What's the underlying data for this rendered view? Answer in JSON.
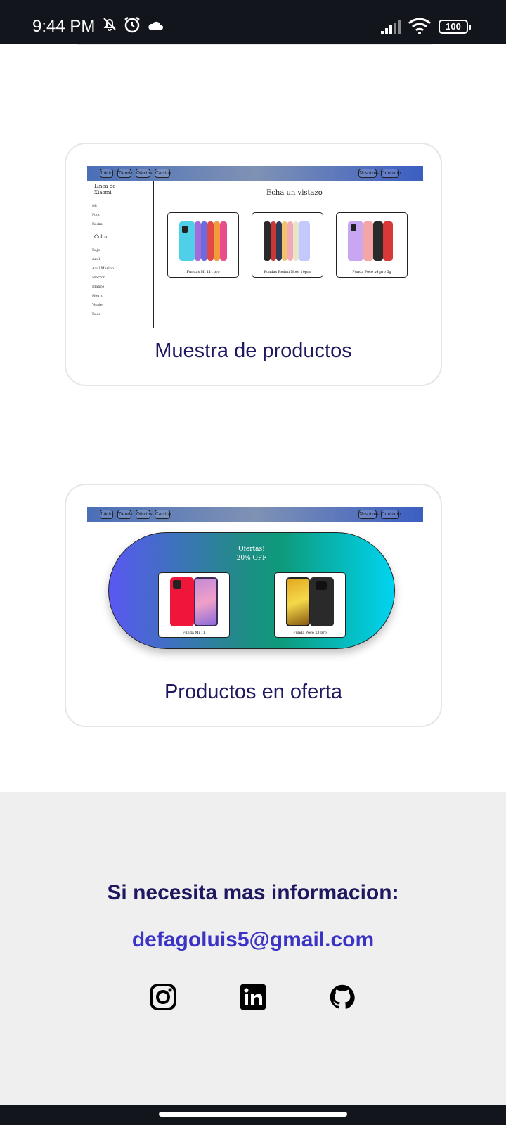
{
  "status_bar": {
    "time": "9:44 PM",
    "battery": "100",
    "icons": [
      "bell-off-icon",
      "alarm-icon",
      "cloud-icon",
      "signal-icon",
      "wifi-icon",
      "battery-icon"
    ]
  },
  "card1": {
    "title": "Muestra de productos",
    "nav": {
      "left": [
        "Inicio",
        "Tienda",
        "Ofertas",
        "Carrito"
      ],
      "right": [
        "Nosotros",
        "Contacto"
      ]
    },
    "sidebar": {
      "heading": "Línea de Xiaomi",
      "lines": [
        "Mi",
        "Poco",
        "Redmi"
      ],
      "color_heading": "Color",
      "colors": [
        "Rojo",
        "Azul",
        "Azul Marino",
        "Marrón",
        "Blanco",
        "Negro",
        "Verde",
        "Rosa"
      ]
    },
    "main_heading": "Echa un vistazo",
    "products": [
      {
        "label": "Fundas Mi 11t pro"
      },
      {
        "label": "Fundas Redmi Note 10pro"
      },
      {
        "label": "Funda Poco x4 pro 5g"
      }
    ]
  },
  "card2": {
    "title": "Productos en oferta",
    "nav": {
      "left": [
        "Inicio",
        "Tienda",
        "Ofertas",
        "Carrito"
      ],
      "right": [
        "Nosotros",
        "Contacto"
      ]
    },
    "offer_title": "Ofertas!",
    "offer_sub": "20% OFF",
    "products": [
      {
        "label": "Funda Mi 11"
      },
      {
        "label": "Funda Poco x3 pro"
      }
    ]
  },
  "footer": {
    "heading": "Si necesita mas informacion:",
    "email": "defagoluis5@gmail.com",
    "social": [
      "instagram-icon",
      "linkedin-icon",
      "github-icon"
    ]
  },
  "colors": {
    "title": "#1e1860",
    "email": "#3b33c6",
    "footer_bg": "#efefef"
  }
}
